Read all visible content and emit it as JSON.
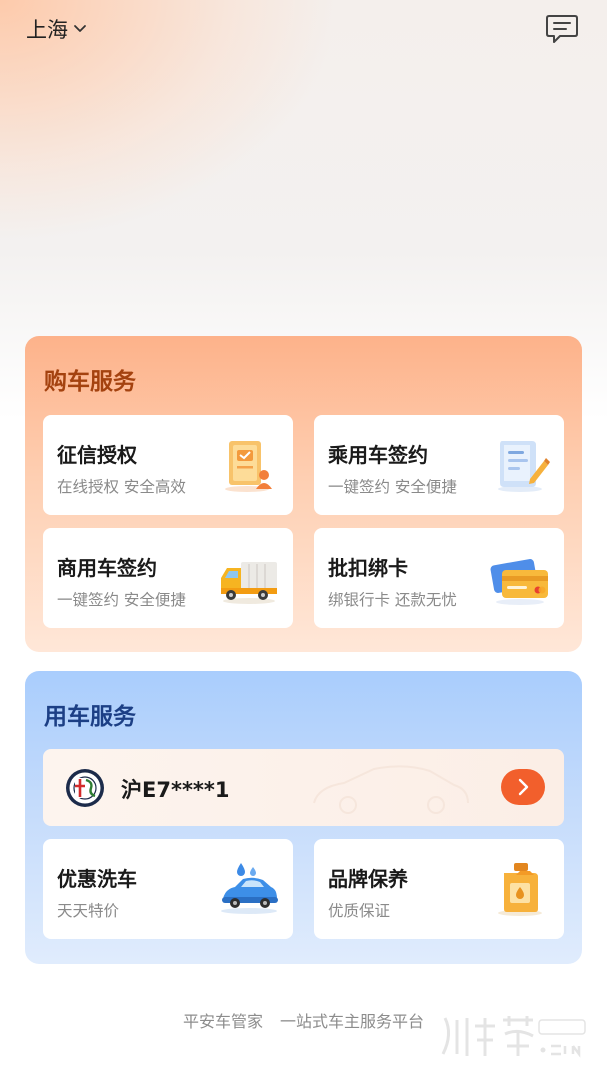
{
  "header": {
    "city": "上海",
    "city_dropdown_icon": "chevron-down-icon",
    "message_icon": "message-icon"
  },
  "purchase_services": {
    "title": "购车服务",
    "cards": [
      {
        "title": "征信授权",
        "subtitle": "在线授权 安全高效",
        "icon": "credit-document-icon"
      },
      {
        "title": "乘用车签约",
        "subtitle": "一键签约 安全便捷",
        "icon": "contract-pen-icon"
      },
      {
        "title": "商用车签约",
        "subtitle": "一键签约 安全便捷",
        "icon": "truck-icon"
      },
      {
        "title": "批扣绑卡",
        "subtitle": "绑银行卡 还款无忧",
        "icon": "bank-card-icon"
      }
    ]
  },
  "vehicle_services": {
    "title": "用车服务",
    "vehicle": {
      "plate": "沪E7****1",
      "brand_logo": "car-brand-logo",
      "arrow_icon": "chevron-right-icon"
    },
    "cards": [
      {
        "title": "优惠洗车",
        "subtitle": "天天特价",
        "icon": "car-wash-icon"
      },
      {
        "title": "品牌保养",
        "subtitle": "优质保证",
        "icon": "oil-can-icon"
      }
    ]
  },
  "footer": {
    "brand": "平安车管家",
    "slogan": "一站式车主服务平台"
  },
  "colors": {
    "accent_orange": "#f25f2c",
    "purchase_title": "#a4420f",
    "vehicle_title": "#1c3f85"
  }
}
